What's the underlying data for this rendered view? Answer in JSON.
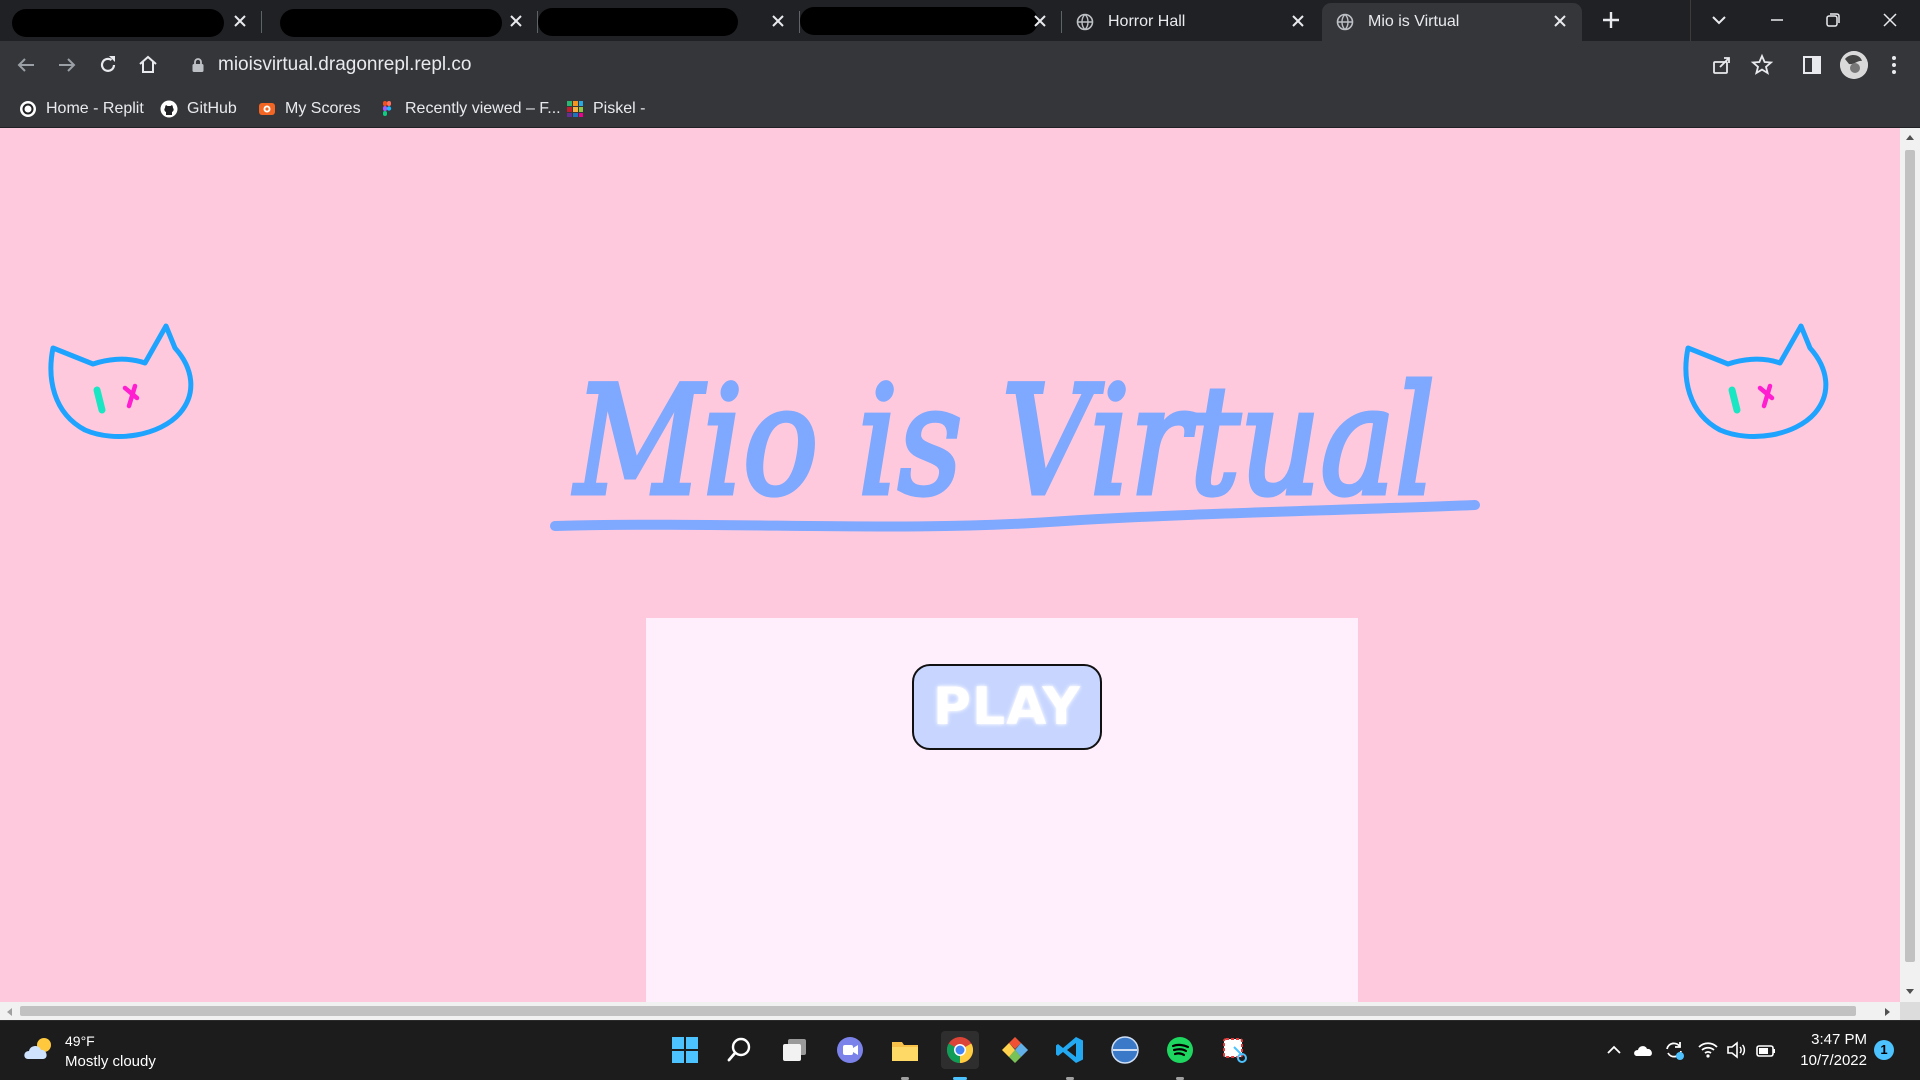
{
  "browser": {
    "tabs": [
      {
        "title": "",
        "redacted": true
      },
      {
        "title": "",
        "redacted": true
      },
      {
        "title": "",
        "redacted": true
      },
      {
        "title": "",
        "redacted": true
      },
      {
        "title": "Horror Hall",
        "icon": "globe-icon"
      },
      {
        "title": "Mio is Virtual",
        "icon": "globe-icon",
        "active": true
      }
    ],
    "new_tab_label": "+",
    "url": "mioisvirtual.dragonrepl.repl.co",
    "bookmarks": [
      {
        "label": "Home - Replit",
        "icon": "replit-icon"
      },
      {
        "label": "GitHub",
        "icon": "github-icon"
      },
      {
        "label": "My Scores",
        "icon": "scores-icon"
      },
      {
        "label": "Recently viewed – F...",
        "icon": "figma-icon"
      },
      {
        "label": "Piskel -",
        "icon": "piskel-icon"
      }
    ]
  },
  "page": {
    "title": "Mio is Virtual",
    "play_label": "PLAY",
    "colors": {
      "background": "#ffc9dd",
      "panel": "#ffeefc",
      "title": "#7fa8ff",
      "button": "#c7d5ff",
      "cat": "#1ea4ff"
    }
  },
  "taskbar": {
    "weather_temp": "49°F",
    "weather_text": "Mostly cloudy",
    "time": "3:47 PM",
    "date": "10/7/2022",
    "notifications": "1",
    "apps": [
      "start-icon",
      "search-icon",
      "task-view-icon",
      "chat-icon",
      "file-explorer-icon",
      "chrome-icon",
      "git-icon",
      "vscode-icon",
      "globe-app-icon",
      "spotify-icon",
      "snipping-tool-icon"
    ]
  }
}
